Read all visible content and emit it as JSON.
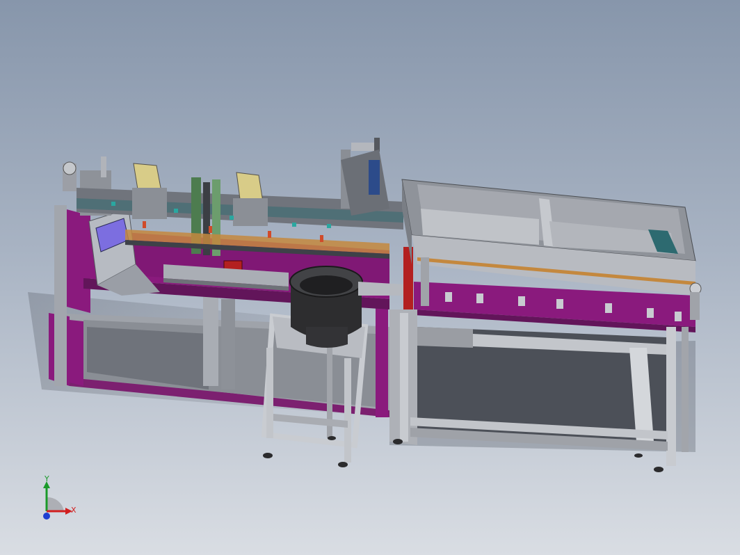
{
  "viewport": {
    "background_top": "#8796ab",
    "background_bottom": "#d9dde3"
  },
  "model": {
    "frame_color": "#8a1a7d",
    "metal_color": "#9a9ea6",
    "dark_color": "#2d2d2f",
    "accent_red": "#b32020",
    "accent_yellow": "#d8cc88"
  },
  "triad": {
    "x_label": "X",
    "y_label": "Y",
    "x_color": "#d11f1f",
    "y_color": "#1a9a2a",
    "z_color": "#1f3fd1"
  }
}
